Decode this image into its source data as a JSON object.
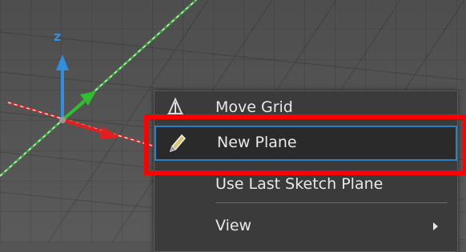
{
  "viewport": {
    "axis_z_label": "z"
  },
  "context_menu": {
    "items": [
      {
        "label": "Move Grid",
        "icon": "move-grid-icon"
      },
      {
        "label": "New Plane",
        "icon": "pencil-plane-icon",
        "state": "hovered"
      },
      {
        "label": "Use Last Sketch Plane",
        "icon": ""
      },
      {
        "label": "View",
        "icon": "",
        "submenu": true
      }
    ]
  },
  "colors": {
    "highlight": "#ff0000",
    "hover_border": "#2f7fbf",
    "menu_bg": "#3b3b3b",
    "axis_x": "#e02020",
    "axis_y": "#2fbf2f",
    "axis_z": "#2f8fe0"
  }
}
